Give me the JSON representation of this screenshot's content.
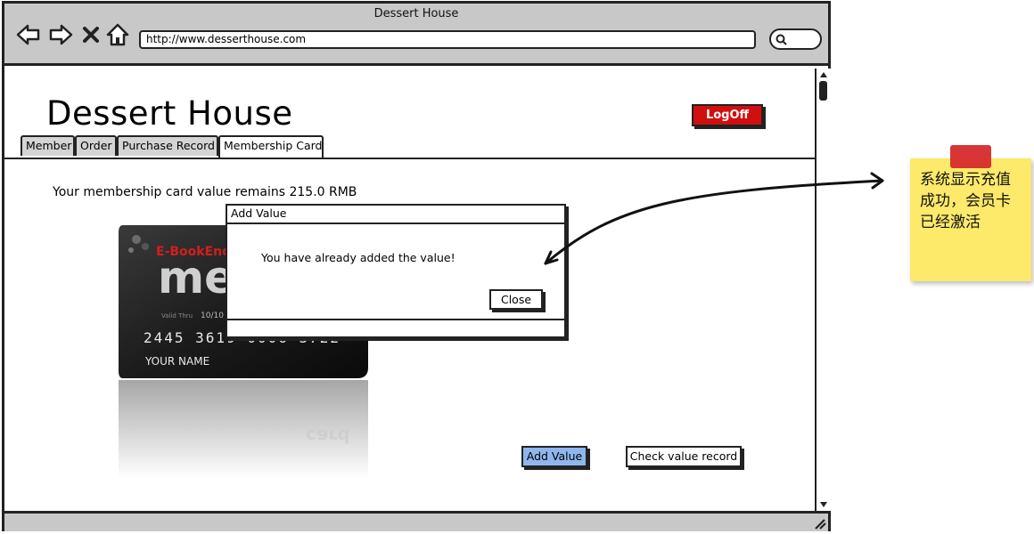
{
  "window": {
    "title": "Dessert House",
    "url": "http://www.desserthouse.com"
  },
  "nav_icons": [
    "back-icon",
    "forward-icon",
    "close-icon",
    "home-icon",
    "search-icon"
  ],
  "page": {
    "site_title": "Dessert House",
    "logoff_label": "LogOff",
    "tabs": [
      {
        "label": "Member",
        "active": false
      },
      {
        "label": "Order",
        "active": false
      },
      {
        "label": "Purchase Record",
        "active": false
      },
      {
        "label": "Membership Card",
        "active": true
      }
    ],
    "card_value_text": "Your membership card value remains 215.0 RMB",
    "card": {
      "brand": "E-BookEnd",
      "big_text": "me",
      "valid_thru_label": "Valid Thru",
      "valid_thru": "10/10",
      "number": "2445 3619 0006 3722",
      "name": "YOUR NAME",
      "reflection_text": "card"
    },
    "add_value_label": "Add Value",
    "check_record_label": "Check value record"
  },
  "dialog": {
    "title": "Add Value",
    "message": "You have already added the value!",
    "close_label": "Close"
  },
  "annotation": {
    "note_text": "系统显示充值成功，会员卡已经激活"
  },
  "colors": {
    "logoff_bg": "#d10f0f",
    "add_value_bg": "#8fb6ee",
    "sticky_note": "#fde96a",
    "sticky_pin": "#d62b2b",
    "chrome": "#c8c8c8"
  }
}
